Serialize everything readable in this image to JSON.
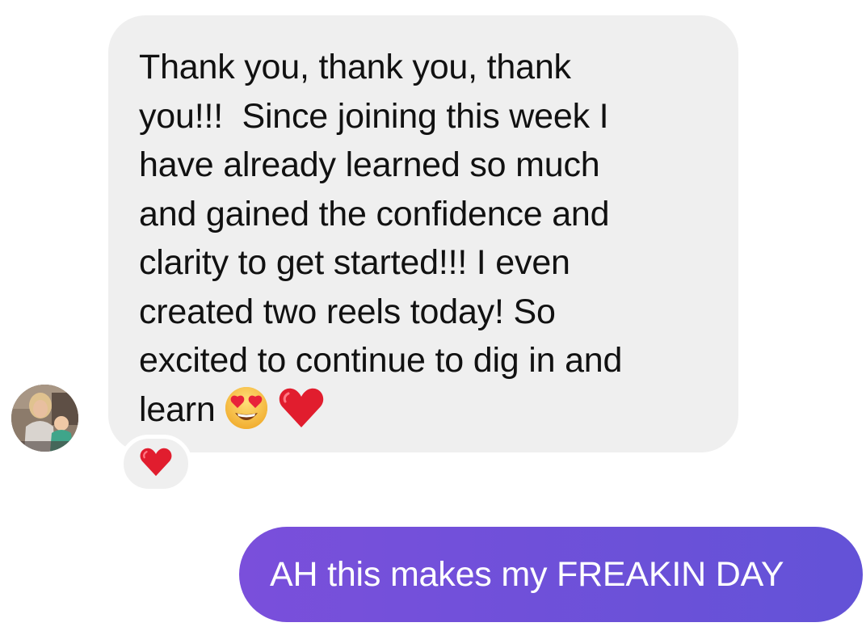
{
  "messages": {
    "incoming": {
      "lines": [
        "Thank you, thank you, thank",
        "you!!!  Since joining this week I",
        "have already learned so much",
        "and gained the confidence and",
        "clarity to get started!!! I even",
        "created two reels today! So",
        "excited to continue to dig in and",
        "learn"
      ],
      "emojis": [
        "heart-eyes-emoji",
        "red-heart-emoji"
      ],
      "reaction": "red-heart-emoji",
      "bubble_color": "#efefef"
    },
    "outgoing": {
      "text": "AH this makes my FREAKIN DAY",
      "bubble_color": "#6a4fd6"
    }
  },
  "avatar": {
    "icon": "profile-photo"
  }
}
